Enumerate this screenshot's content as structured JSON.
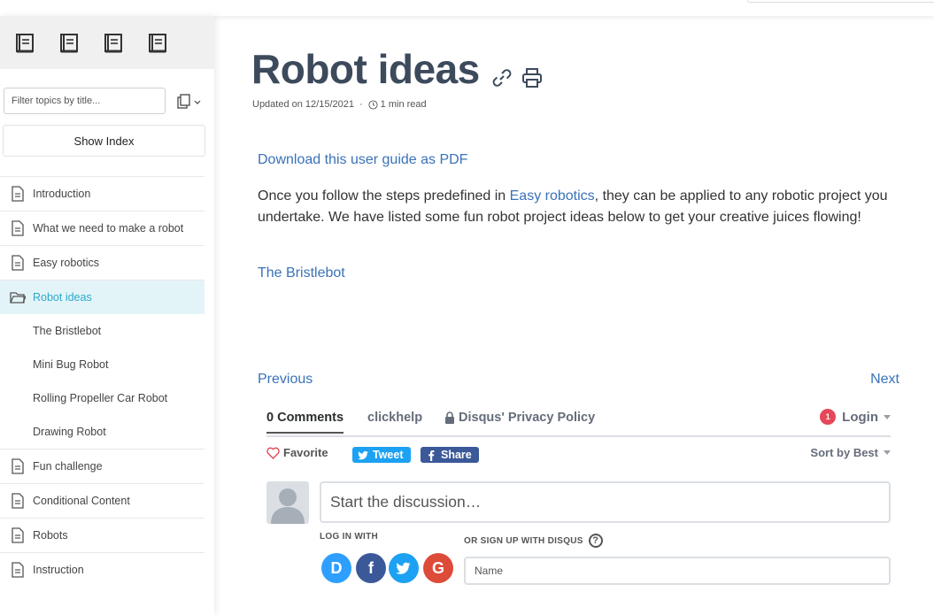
{
  "sidebar": {
    "book_icons": [
      "book-icon",
      "book-icon",
      "book-icon",
      "book-icon"
    ],
    "filter_placeholder": "Filter topics by title...",
    "show_index_label": "Show Index",
    "items": [
      {
        "label": "Introduction",
        "icon": "document-icon"
      },
      {
        "label": "What we need to make a robot",
        "icon": "document-icon"
      },
      {
        "label": "Easy robotics",
        "icon": "document-icon"
      },
      {
        "label": "Robot ideas",
        "icon": "folder-open-icon",
        "active": true
      },
      {
        "label": "The Bristlebot"
      },
      {
        "label": "Mini Bug Robot"
      },
      {
        "label": "Rolling Propeller Car Robot"
      },
      {
        "label": "Drawing Robot"
      },
      {
        "label": "Fun challenge",
        "icon": "document-icon"
      },
      {
        "label": "Conditional Content",
        "icon": "document-icon"
      },
      {
        "label": "Robots",
        "icon": "document-icon"
      },
      {
        "label": "Instruction",
        "icon": "document-icon"
      }
    ]
  },
  "article": {
    "title": "Robot ideas",
    "updated": "Updated on 12/15/2021",
    "separator": "·",
    "read_time": "1 min read",
    "pdf_link": "Download this user guide as PDF",
    "paragraph_before": "Once you follow the steps predefined in ",
    "paragraph_link": "Easy robotics",
    "paragraph_after": ", they can be applied to any robotic project you undertake. We have listed some fun robot project ideas below to get your creative juices flowing!",
    "subtopic_link": "The Bristlebot",
    "previous": "Previous",
    "next": "Next"
  },
  "disqus": {
    "comments_tab": "0 Comments",
    "site_tab": "clickhelp",
    "privacy_tab": "Disqus' Privacy Policy",
    "login_badge": "1",
    "login": "Login",
    "favorite": "Favorite",
    "tweet": "Tweet",
    "share": "Share",
    "sort": "Sort by Best",
    "discussion_placeholder": "Start the discussion…",
    "login_with": "LOG IN WITH",
    "or_signup": "OR SIGN UP WITH DISQUS",
    "help_symbol": "?",
    "name_placeholder": "Name",
    "social": [
      {
        "letter": "D",
        "color": "#2e9fff",
        "icon": "disqus-icon"
      },
      {
        "letter": "f",
        "color": "#3b5998",
        "icon": "facebook-icon"
      },
      {
        "letter": "t",
        "color": "#1da1f2",
        "icon": "twitter-icon"
      },
      {
        "letter": "G",
        "color": "#dd4b39",
        "icon": "google-icon"
      }
    ]
  },
  "colors": {
    "link": "#3a72b8",
    "active_nav_bg": "#e3f4f8",
    "active_nav_text": "#2aa9cc",
    "title": "#3c4a5c"
  }
}
